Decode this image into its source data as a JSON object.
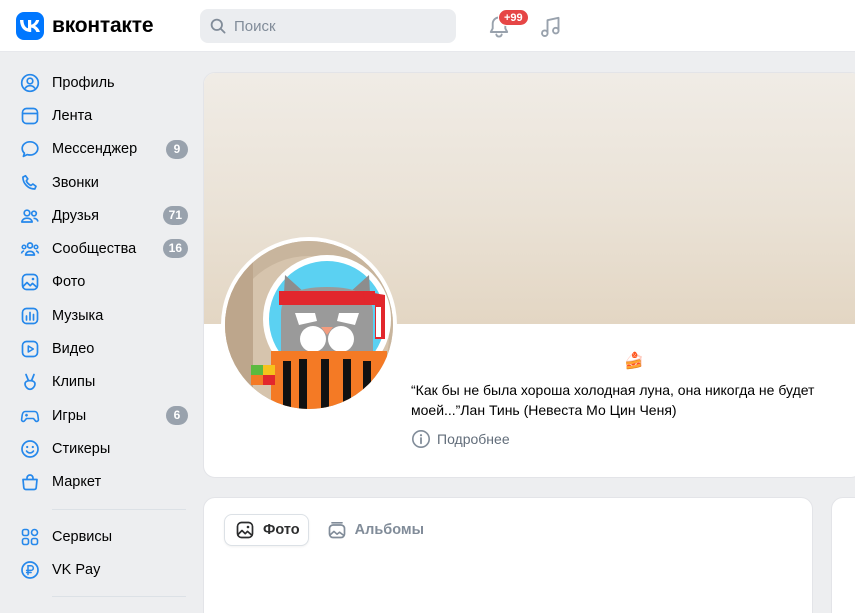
{
  "header": {
    "logo_text": "вконтакте",
    "search_placeholder": "Поиск",
    "notifications_badge": "+99"
  },
  "sidebar": {
    "items": [
      {
        "label": "Профиль",
        "icon": "user-circle-icon"
      },
      {
        "label": "Лента",
        "icon": "feed-icon"
      },
      {
        "label": "Мессенджер",
        "icon": "message-icon",
        "count": "9"
      },
      {
        "label": "Звонки",
        "icon": "phone-icon"
      },
      {
        "label": "Друзья",
        "icon": "friends-icon",
        "count": "71"
      },
      {
        "label": "Сообщества",
        "icon": "communities-icon",
        "count": "16"
      },
      {
        "label": "Фото",
        "icon": "photo-icon"
      },
      {
        "label": "Музыка",
        "icon": "music-icon"
      },
      {
        "label": "Видео",
        "icon": "video-icon"
      },
      {
        "label": "Клипы",
        "icon": "clips-icon"
      },
      {
        "label": "Игры",
        "icon": "games-icon",
        "count": "6"
      },
      {
        "label": "Стикеры",
        "icon": "sticker-icon"
      },
      {
        "label": "Маркет",
        "icon": "market-icon"
      }
    ],
    "extra_items": [
      {
        "label": "Сервисы",
        "icon": "services-icon"
      },
      {
        "label": "VK Pay",
        "icon": "vkpay-icon"
      }
    ]
  },
  "profile": {
    "status_emoji": "🍰",
    "status_text": "“Как бы не была хороша холодная луна, она никогда не будет моей...”Лан Тинь (Невеста Мо Цин Ченя)",
    "more_label": "Подробнее"
  },
  "photos": {
    "tabs": [
      {
        "label": "Фото",
        "active": true
      },
      {
        "label": "Альбомы",
        "active": false
      }
    ]
  },
  "colors": {
    "accent": "#0077ff",
    "icon_blue": "#2688eb",
    "badge_red": "#e64646",
    "counter_gray": "#99a2ad",
    "background": "#edeef0"
  }
}
